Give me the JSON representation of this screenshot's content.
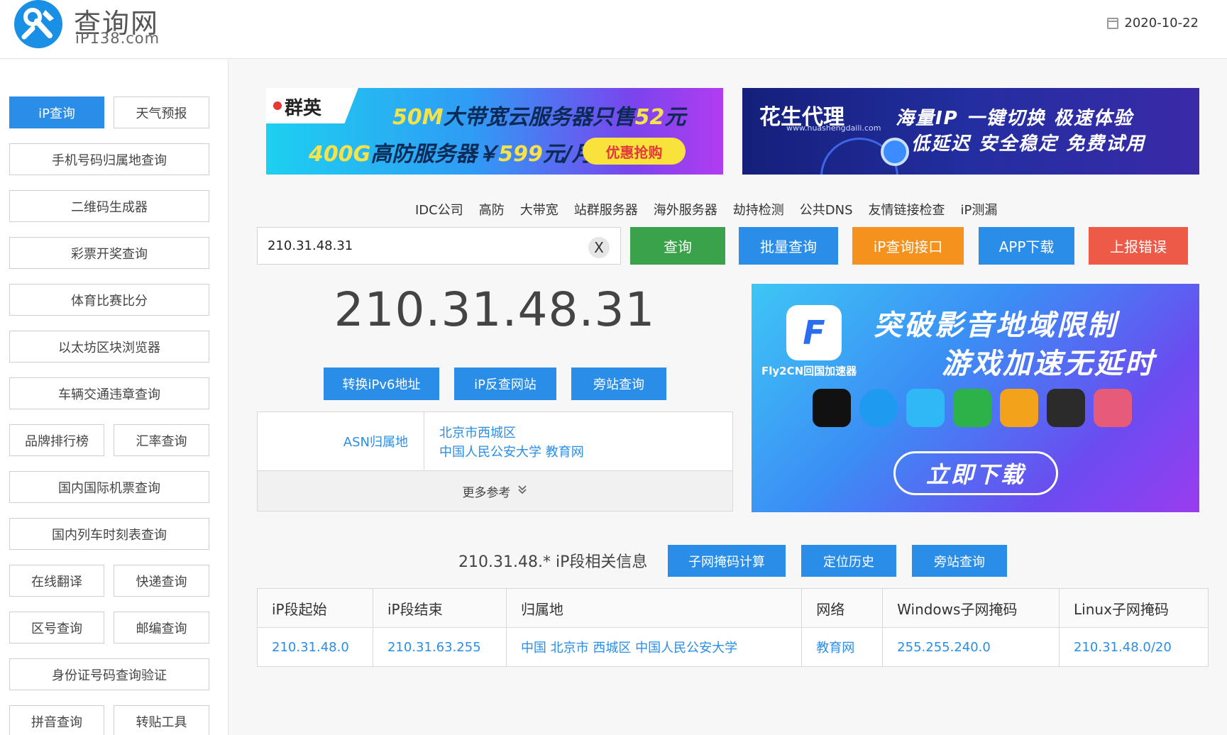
{
  "header": {
    "logo_cn": "查询网",
    "logo_en": "iP138.com",
    "date": "2020-10-22"
  },
  "sidebar": {
    "items": [
      {
        "label": "iP查询",
        "active": true
      },
      {
        "label": "天气预报"
      },
      {
        "label": "手机号码归属地查询"
      },
      {
        "label": "二维码生成器"
      },
      {
        "label": "彩票开奖查询"
      },
      {
        "label": "体育比赛比分"
      },
      {
        "label": "以太坊区块浏览器"
      },
      {
        "label": "车辆交通违章查询"
      },
      {
        "label": "品牌排行榜"
      },
      {
        "label": "汇率查询"
      },
      {
        "label": "国内国际机票查询"
      },
      {
        "label": "国内列车时刻表查询"
      },
      {
        "label": "在线翻译"
      },
      {
        "label": "快递查询"
      },
      {
        "label": "区号查询"
      },
      {
        "label": "邮编查询"
      },
      {
        "label": "身份证号码查询验证"
      },
      {
        "label": "拼音查询"
      },
      {
        "label": "转贴工具"
      }
    ]
  },
  "banners": {
    "qunying": {
      "brand": "群英",
      "line1_prefix": "50M",
      "line1_main": "大带宽云服务器只售",
      "line1_num": "52",
      "line1_unit": "元",
      "line2_prefix": "400G",
      "line2_main": "高防服务器￥",
      "line2_num": "599",
      "line2_unit": "元/月",
      "cta": "优惠抢购"
    },
    "huasheng": {
      "brand": "花生代理",
      "url": "www.huashengdaili.com",
      "line1": "海量IP 一键切换 极速体验",
      "line2": "低延迟 安全稳定 免费试用"
    },
    "fly2cn": {
      "app_name": "Fly2CN回国加速器",
      "line1": "突破影音地域限制",
      "line2": "游戏加速无延时",
      "cta": "立即下载"
    }
  },
  "nav": [
    "IDC公司",
    "高防",
    "大带宽",
    "站群服务器",
    "海外服务器",
    "劫持检测",
    "公共DNS",
    "友情链接检查",
    "iP测漏"
  ],
  "search": {
    "value": "210.31.48.31",
    "clear": "X"
  },
  "actions": {
    "query": "查询",
    "batch": "批量查询",
    "api": "iP查询接口",
    "app": "APP下载",
    "report": "上报错误"
  },
  "result": {
    "ip": "210.31.48.31",
    "btn_ipv6": "转换iPv6地址",
    "btn_reverse": "iP反查网站",
    "btn_side": "旁站查询",
    "asn_label": "ASN归属地",
    "asn_line1": "北京市西城区",
    "asn_line2": "中国人民公安大学 教育网",
    "more": "更多参考"
  },
  "segment": {
    "title": "210.31.48.* iP段相关信息",
    "btn_subnet": "子网掩码计算",
    "btn_history": "定位历史",
    "btn_side": "旁站查询",
    "columns": [
      "iP段起始",
      "iP段结束",
      "归属地",
      "网络",
      "Windows子网掩码",
      "Linux子网掩码"
    ],
    "rows": [
      [
        "210.31.48.0",
        "210.31.63.255",
        "中国 北京市 西城区 中国人民公安大学",
        "教育网",
        "255.255.240.0",
        "210.31.48.0/20"
      ]
    ]
  },
  "colors": {
    "blue": "#2a8ee8",
    "green": "#3aa24a",
    "orange": "#f5921e",
    "red": "#ed5a48"
  }
}
